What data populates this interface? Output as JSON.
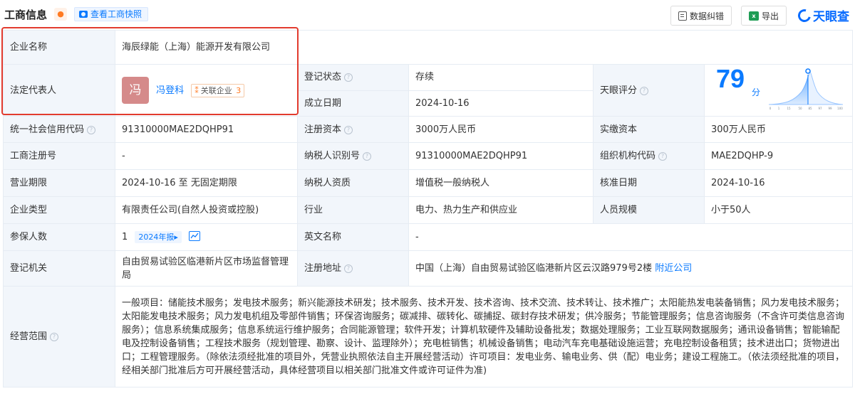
{
  "header": {
    "title": "工商信息",
    "snapshot_label": "查看工商快照",
    "correct_label": "数据纠错",
    "export_label": "导出",
    "brand": "天眼查",
    "excel_glyph": "x"
  },
  "labels": {
    "company_name": "企业名称",
    "legal_rep": "法定代表人",
    "reg_status": "登记状态",
    "founded": "成立日期",
    "tianyan_score": "天眼评分",
    "credit_code": "统一社会信用代码",
    "reg_capital": "注册资本",
    "paid_capital": "实缴资本",
    "biz_reg_no": "工商注册号",
    "taxpayer_id": "纳税人识别号",
    "org_code": "组织机构代码",
    "biz_term": "营业期限",
    "taxpayer_type": "纳税人资质",
    "approval_date": "核准日期",
    "company_type": "企业类型",
    "industry": "行业",
    "staff_size": "人员规模",
    "insured_count": "参保人数",
    "english_name": "英文名称",
    "reg_authority": "登记机关",
    "reg_address": "注册地址",
    "biz_scope": "经营范围"
  },
  "values": {
    "company_name": "海辰绿能（上海）能源开发有限公司",
    "avatar_char": "冯",
    "legal_rep_name": "冯登科",
    "related_label": "关联企业",
    "related_count": "3",
    "reg_status": "存续",
    "founded": "2024-10-16",
    "score": "79",
    "score_unit": "分",
    "credit_code": "91310000MAE2DQHP91",
    "reg_capital": "3000万人民币",
    "paid_capital": "300万人民币",
    "biz_reg_no": "-",
    "taxpayer_id": "91310000MAE2DQHP91",
    "org_code": "MAE2DQHP-9",
    "biz_term": "2024-10-16 至 无固定期限",
    "taxpayer_type": "增值税一般纳税人",
    "approval_date": "2024-10-16",
    "company_type": "有限责任公司(自然人投资或控股)",
    "industry": "电力、热力生产和供应业",
    "staff_size": "小于50人",
    "insured_count": "1",
    "insured_year_tag": "2024年报",
    "english_name": "-",
    "reg_authority": "自由贸易试验区临港新片区市场监督管理局",
    "reg_address": "中国（上海）自由贸易试验区临港新片区云汉路979号2楼",
    "nearby_label": "附近公司",
    "biz_scope": "一般项目：储能技术服务；发电技术服务；新兴能源技术研发；技术服务、技术开发、技术咨询、技术交流、技术转让、技术推广；太阳能热发电装备销售；风力发电技术服务；太阳能发电技术服务；风力发电机组及零部件销售；环保咨询服务；碳减排、碳转化、碳捕捉、碳封存技术研发；供冷服务；节能管理服务；信息咨询服务（不含许可类信息咨询服务）；信息系统集成服务；信息系统运行维护服务；合同能源管理；软件开发；计算机软硬件及辅助设备批发；数据处理服务；工业互联网数据服务；通讯设备销售；智能输配电及控制设备销售；工程技术服务（规划管理、勘察、设计、监理除外）；充电桩销售；机械设备销售；电动汽车充电基础设施运营；充电控制设备租赁；技术进出口；货物进出口；工程管理服务。（除依法须经批准的项目外，凭营业执照依法自主开展经营活动）许可项目：发电业务、输电业务、供（配）电业务；建设工程施工。（依法须经批准的项目，经相关部门批准后方可开展经营活动，具体经营项目以相关部门批准文件或许可证件为准)"
  },
  "score_chart": {
    "ticks": [
      "0",
      "1",
      "15",
      "50",
      "85",
      "97",
      "99",
      "100"
    ],
    "marker": "79",
    "accent": "#0a7aff"
  },
  "colors": {
    "accent": "#0a7aff",
    "status_active": "#21b36b",
    "highlight_box": "#e23b2e",
    "label_bg": "#f2f6fb"
  },
  "icons": [
    "bell-icon",
    "camera-icon",
    "document-icon",
    "excel-icon",
    "question-icon",
    "related-icon",
    "trend-icon",
    "brand-logo"
  ]
}
